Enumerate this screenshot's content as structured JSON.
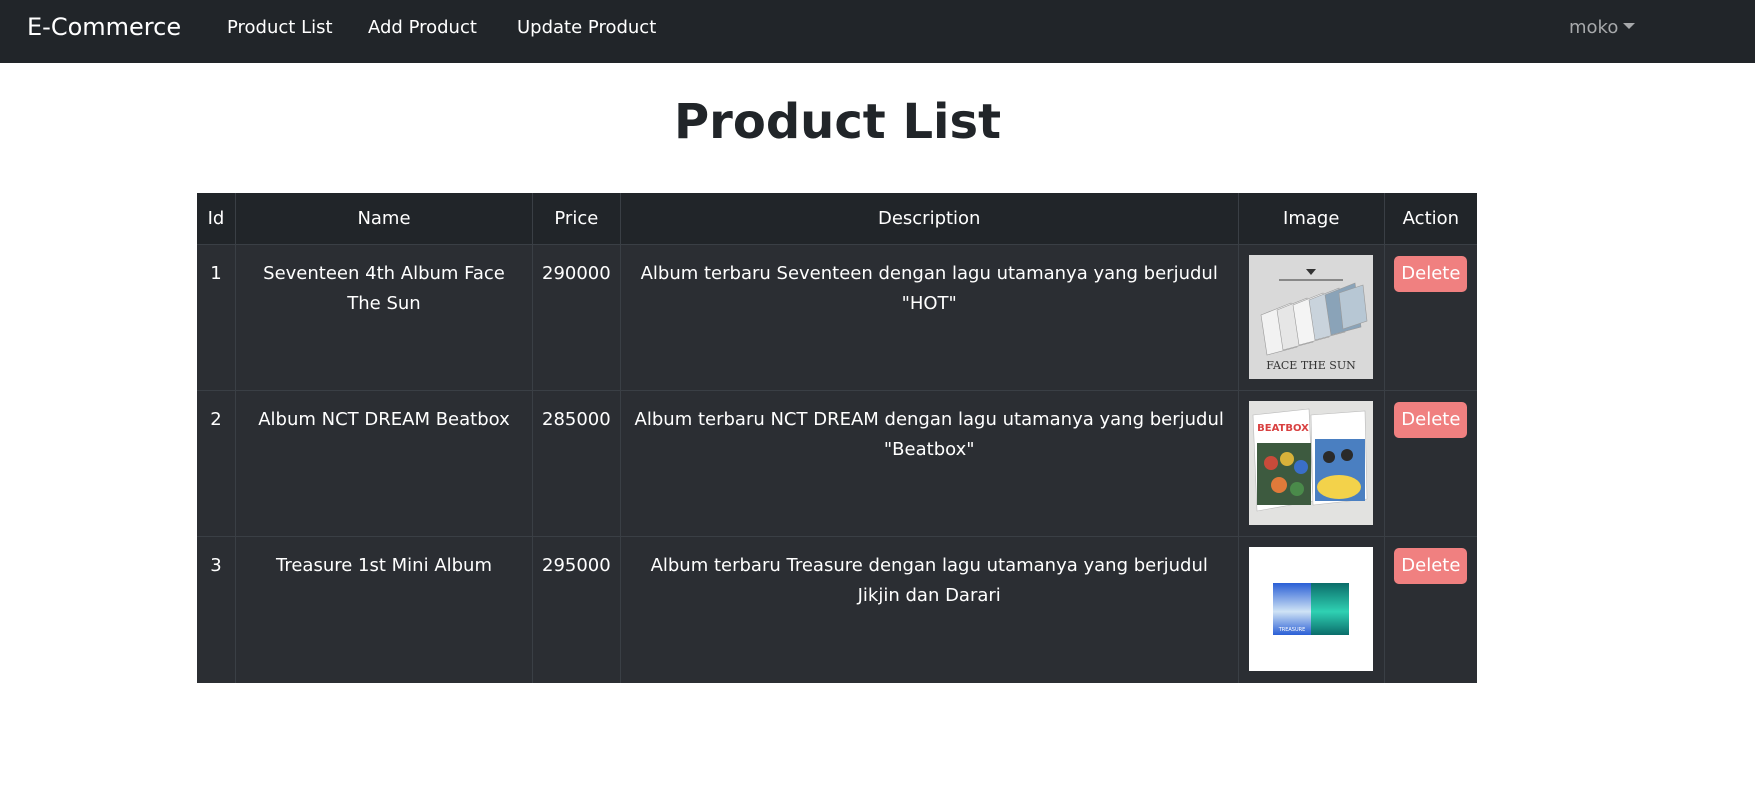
{
  "navbar": {
    "brand": "E-Commerce",
    "links": [
      "Product List",
      "Add Product",
      "Update Product"
    ],
    "user": "moko"
  },
  "page": {
    "title": "Product List"
  },
  "table": {
    "headers": [
      "Id",
      "Name",
      "Price",
      "Description",
      "Image",
      "Action"
    ],
    "rows": [
      {
        "id": "1",
        "name": "Seventeen 4th Album Face The Sun",
        "price": "290000",
        "description": "Album terbaru Seventeen dengan lagu utamanya yang berjudul \"HOT\"",
        "image_caption": "FACE THE SUN",
        "action": "Delete"
      },
      {
        "id": "2",
        "name": "Album NCT DREAM Beatbox",
        "price": "285000",
        "description": "Album terbaru NCT DREAM dengan lagu utamanya yang berjudul \"Beatbox\"",
        "image_caption": "BEATBOX",
        "action": "Delete"
      },
      {
        "id": "3",
        "name": "Treasure 1st Mini Album",
        "price": "295000",
        "description": "Album terbaru Treasure dengan lagu utamanya yang berjudul Jikjin dan Darari",
        "image_caption": "TREASURE",
        "action": "Delete"
      }
    ]
  },
  "colors": {
    "navbar_bg": "#212529",
    "table_bg": "#2b2e33",
    "delete_button": "#f08080"
  }
}
